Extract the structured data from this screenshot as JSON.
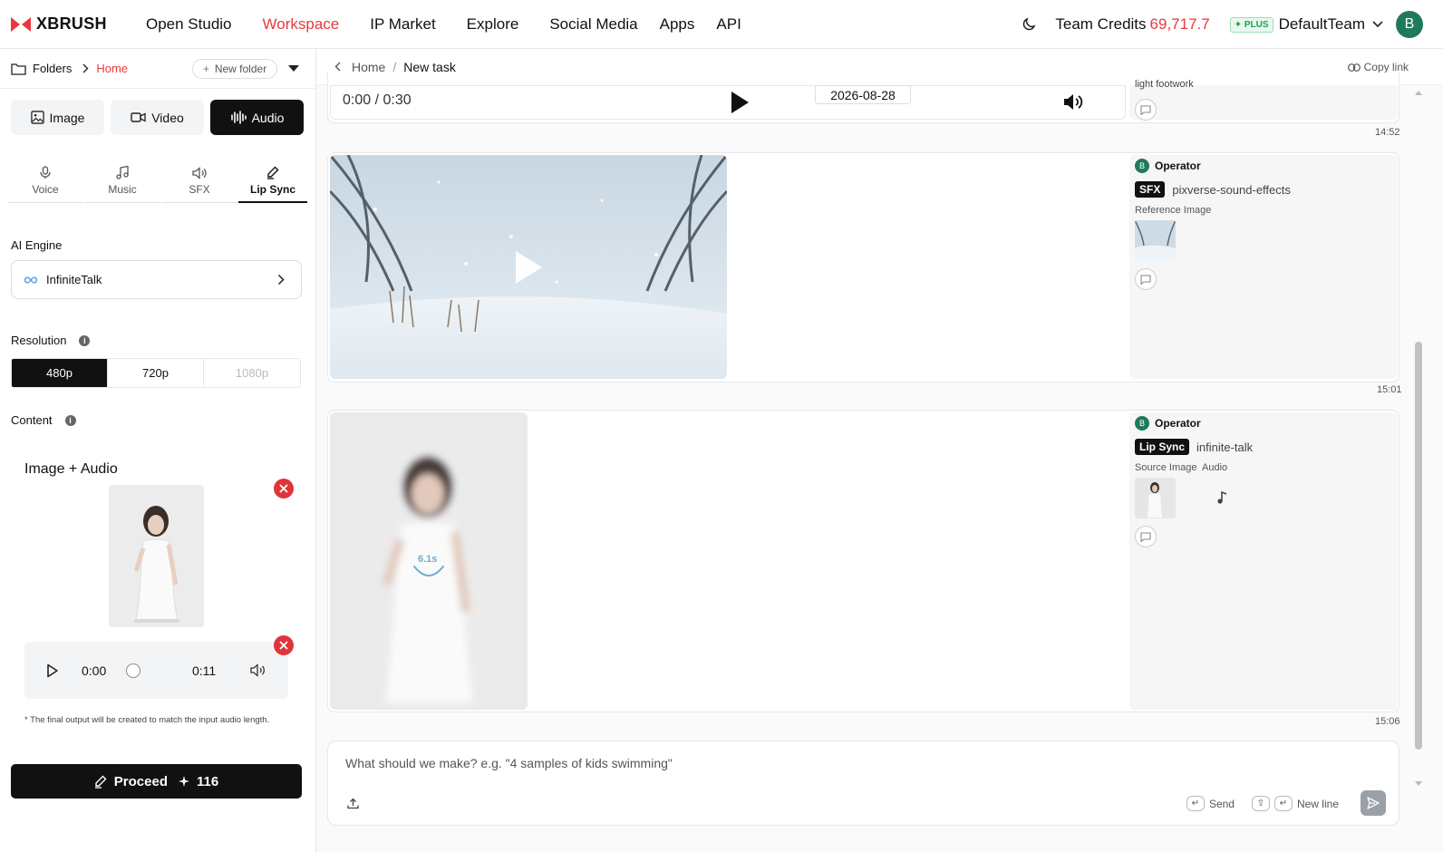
{
  "brand": {
    "name": "XBRUSH"
  },
  "nav": {
    "items": [
      {
        "label": "Open Studio"
      },
      {
        "label": "Workspace"
      },
      {
        "label": "IP Market"
      },
      {
        "label": "Explore"
      },
      {
        "label": "Social Media"
      },
      {
        "label": "Apps"
      },
      {
        "label": "API"
      }
    ],
    "active": "Workspace"
  },
  "account": {
    "credits_label": "Team Credits",
    "credits_value": "69,717.7",
    "plan_badge": "PLUS",
    "team_name": "DefaultTeam",
    "avatar_letter": "B"
  },
  "sidebar": {
    "folders_label": "Folders",
    "home_label": "Home",
    "new_folder_label": "New folder",
    "modes": [
      {
        "label": "Image",
        "icon": "image-icon"
      },
      {
        "label": "Video",
        "icon": "video-icon"
      },
      {
        "label": "Audio",
        "icon": "waveform-icon"
      }
    ],
    "active_mode": "Audio",
    "sub_tabs": [
      {
        "label": "Voice",
        "icon": "mic-icon"
      },
      {
        "label": "Music",
        "icon": "music-note-icon"
      },
      {
        "label": "SFX",
        "icon": "speaker-icon"
      },
      {
        "label": "Lip Sync",
        "icon": "pen-icon"
      }
    ],
    "active_sub_tab": "Lip Sync",
    "engine_label": "AI Engine",
    "engine_value": "InfiniteTalk",
    "resolution_label": "Resolution",
    "resolutions": [
      {
        "label": "480p",
        "state": "active"
      },
      {
        "label": "720p",
        "state": "normal"
      },
      {
        "label": "1080p",
        "state": "disabled"
      }
    ],
    "content_label": "Content",
    "content_title": "Image + Audio",
    "audio_start": "0:00",
    "audio_end": "0:11",
    "progress": 0,
    "note": "* The final output will be created to match the input audio length.",
    "proceed_label": "Proceed",
    "proceed_cost": "116"
  },
  "main": {
    "breadcrumb_home": "Home",
    "breadcrumb_current": "New task",
    "copy_link_label": "Copy link",
    "first_card": {
      "player_time": "0:00 / 0:30",
      "date": "2026-08-28",
      "truncated_text": "light footwork",
      "timestamp": "14:52"
    },
    "sfx_card": {
      "operator": "Operator",
      "operator_initial": "B",
      "tag": "SFX",
      "model": "pixverse-sound-effects",
      "ref_label": "Reference Image",
      "timestamp": "15:01"
    },
    "lipsync_card": {
      "operator": "Operator",
      "operator_initial": "B",
      "tag": "Lip Sync",
      "model": "infinite-talk",
      "source_label": "Source Image",
      "audio_label": "Audio",
      "elapsed": "6.1s",
      "timestamp": "15:06"
    },
    "prompt": {
      "placeholder": "What should we make? e.g. \"4 samples of kids swimming\"",
      "send_hint": "Send",
      "newline_hint": "New line"
    }
  },
  "colors": {
    "accent_red": "#e8383d",
    "plus_green": "#18a04d",
    "avatar_green": "#1f7a5c",
    "remove_red": "#e0343a",
    "dark": "#111111"
  }
}
